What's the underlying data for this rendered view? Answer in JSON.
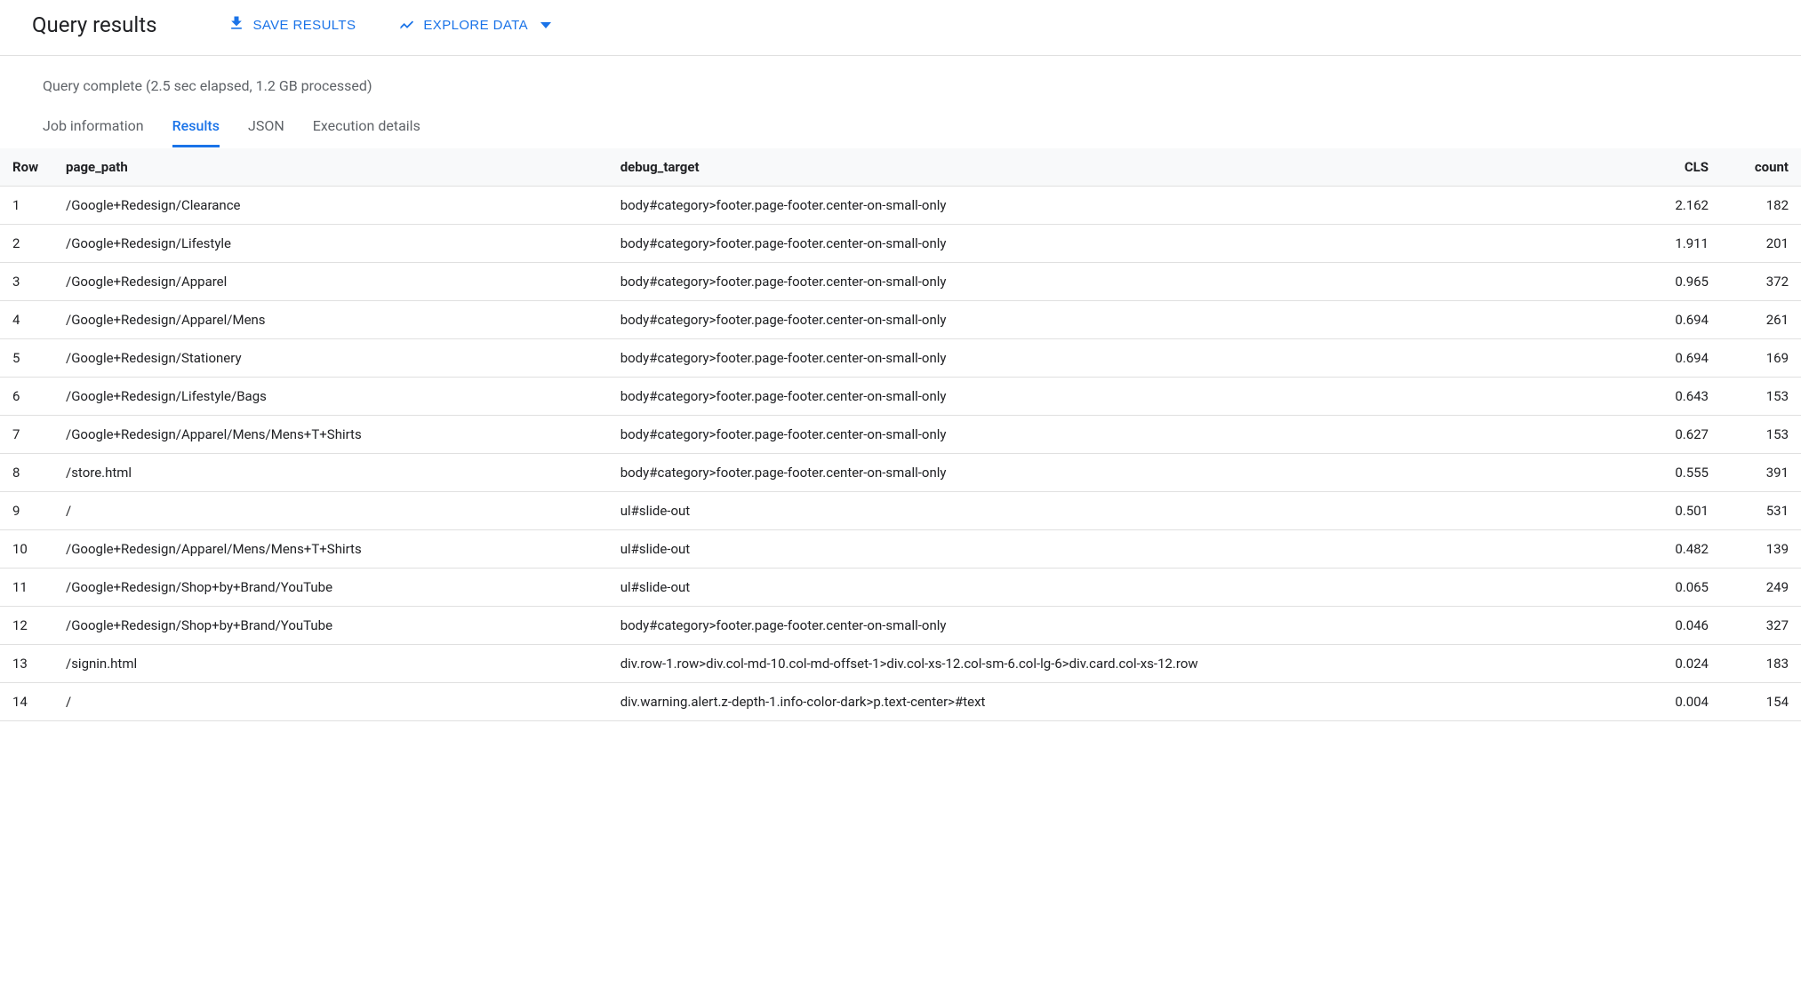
{
  "header": {
    "title": "Query results",
    "save_label": "SAVE RESULTS",
    "explore_label": "EXPLORE DATA"
  },
  "status_text": "Query complete (2.5 sec elapsed, 1.2 GB processed)",
  "tabs": [
    {
      "label": "Job information",
      "active": false
    },
    {
      "label": "Results",
      "active": true
    },
    {
      "label": "JSON",
      "active": false
    },
    {
      "label": "Execution details",
      "active": false
    }
  ],
  "table": {
    "columns": [
      {
        "key": "row",
        "label": "Row",
        "numeric": false
      },
      {
        "key": "page_path",
        "label": "page_path",
        "numeric": false
      },
      {
        "key": "debug_target",
        "label": "debug_target",
        "numeric": false
      },
      {
        "key": "CLS",
        "label": "CLS",
        "numeric": true
      },
      {
        "key": "count",
        "label": "count",
        "numeric": true
      }
    ],
    "rows": [
      {
        "row": 1,
        "page_path": "/Google+Redesign/Clearance",
        "debug_target": "body#category>footer.page-footer.center-on-small-only",
        "CLS": "2.162",
        "count": 182
      },
      {
        "row": 2,
        "page_path": "/Google+Redesign/Lifestyle",
        "debug_target": "body#category>footer.page-footer.center-on-small-only",
        "CLS": "1.911",
        "count": 201
      },
      {
        "row": 3,
        "page_path": "/Google+Redesign/Apparel",
        "debug_target": "body#category>footer.page-footer.center-on-small-only",
        "CLS": "0.965",
        "count": 372
      },
      {
        "row": 4,
        "page_path": "/Google+Redesign/Apparel/Mens",
        "debug_target": "body#category>footer.page-footer.center-on-small-only",
        "CLS": "0.694",
        "count": 261
      },
      {
        "row": 5,
        "page_path": "/Google+Redesign/Stationery",
        "debug_target": "body#category>footer.page-footer.center-on-small-only",
        "CLS": "0.694",
        "count": 169
      },
      {
        "row": 6,
        "page_path": "/Google+Redesign/Lifestyle/Bags",
        "debug_target": "body#category>footer.page-footer.center-on-small-only",
        "CLS": "0.643",
        "count": 153
      },
      {
        "row": 7,
        "page_path": "/Google+Redesign/Apparel/Mens/Mens+T+Shirts",
        "debug_target": "body#category>footer.page-footer.center-on-small-only",
        "CLS": "0.627",
        "count": 153
      },
      {
        "row": 8,
        "page_path": "/store.html",
        "debug_target": "body#category>footer.page-footer.center-on-small-only",
        "CLS": "0.555",
        "count": 391
      },
      {
        "row": 9,
        "page_path": "/",
        "debug_target": "ul#slide-out",
        "CLS": "0.501",
        "count": 531
      },
      {
        "row": 10,
        "page_path": "/Google+Redesign/Apparel/Mens/Mens+T+Shirts",
        "debug_target": "ul#slide-out",
        "CLS": "0.482",
        "count": 139
      },
      {
        "row": 11,
        "page_path": "/Google+Redesign/Shop+by+Brand/YouTube",
        "debug_target": "ul#slide-out",
        "CLS": "0.065",
        "count": 249
      },
      {
        "row": 12,
        "page_path": "/Google+Redesign/Shop+by+Brand/YouTube",
        "debug_target": "body#category>footer.page-footer.center-on-small-only",
        "CLS": "0.046",
        "count": 327
      },
      {
        "row": 13,
        "page_path": "/signin.html",
        "debug_target": "div.row-1.row>div.col-md-10.col-md-offset-1>div.col-xs-12.col-sm-6.col-lg-6>div.card.col-xs-12.row",
        "CLS": "0.024",
        "count": 183
      },
      {
        "row": 14,
        "page_path": "/",
        "debug_target": "div.warning.alert.z-depth-1.info-color-dark>p.text-center>#text",
        "CLS": "0.004",
        "count": 154
      }
    ]
  }
}
